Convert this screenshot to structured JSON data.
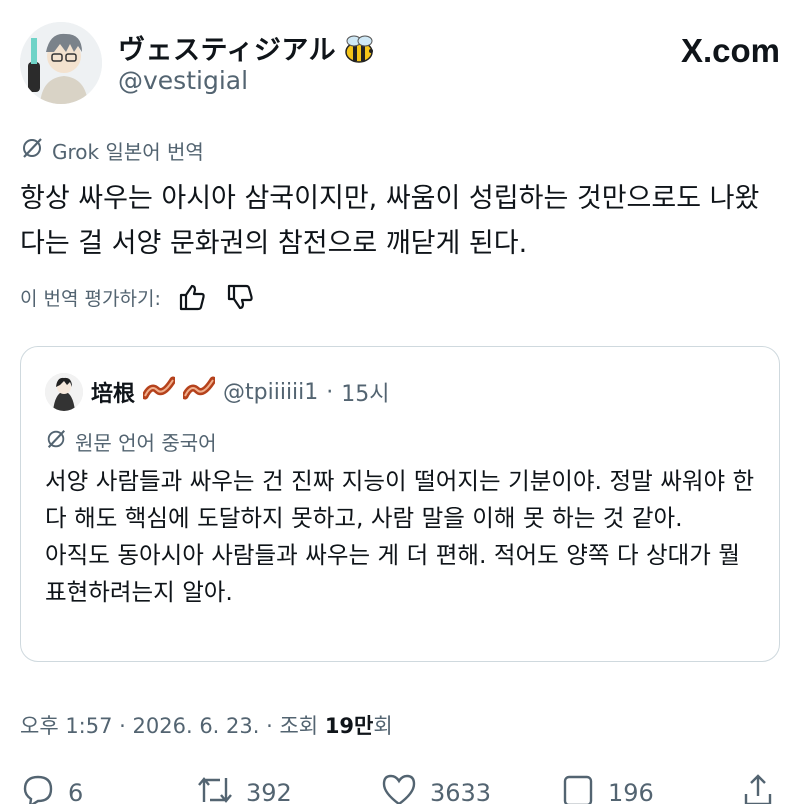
{
  "author": {
    "display_name": "ヴェスティジアル",
    "handle": "@vestigial"
  },
  "brand": "X.com",
  "translation": {
    "label": "Grok 일본어 번역",
    "text": "항상 싸우는 아시아 삼국이지만, 싸움이 성립하는 것만으로도 나왔다는 걸 서양 문화권의 참전으로 깨닫게 된다.",
    "rate_label": "이 번역 평가하기:"
  },
  "quote": {
    "name": "培根",
    "handle": "@tpiiiiii1",
    "sep": "·",
    "time": "15시",
    "translate_label": "원문 언어 중국어",
    "text": "서양 사람들과 싸우는 건 진짜 지능이 떨어지는 기분이야. 정말 싸워야 한다 해도 핵심에 도달하지 못하고, 사람 말을 이해 못 하는 것 같아.\n아직도 동아시아 사람들과 싸우는 게 더 편해. 적어도 양쪽 다 상대가 뭘 표현하려는지 알아."
  },
  "meta": {
    "time": "오후 1:57",
    "date": "2026. 6. 23.",
    "views_label": "조회",
    "views_value": "19만",
    "views_suffix": "회"
  },
  "actions": {
    "replies": "6",
    "reposts": "392",
    "likes": "3633",
    "bookmarks": "196"
  },
  "icons": [
    "bee-emoji-icon",
    "grok-slash-icon",
    "thumbs-up-icon",
    "thumbs-down-icon",
    "bacon-emoji-icon",
    "reply-icon",
    "repost-icon",
    "like-icon",
    "bookmark-icon",
    "share-icon"
  ]
}
